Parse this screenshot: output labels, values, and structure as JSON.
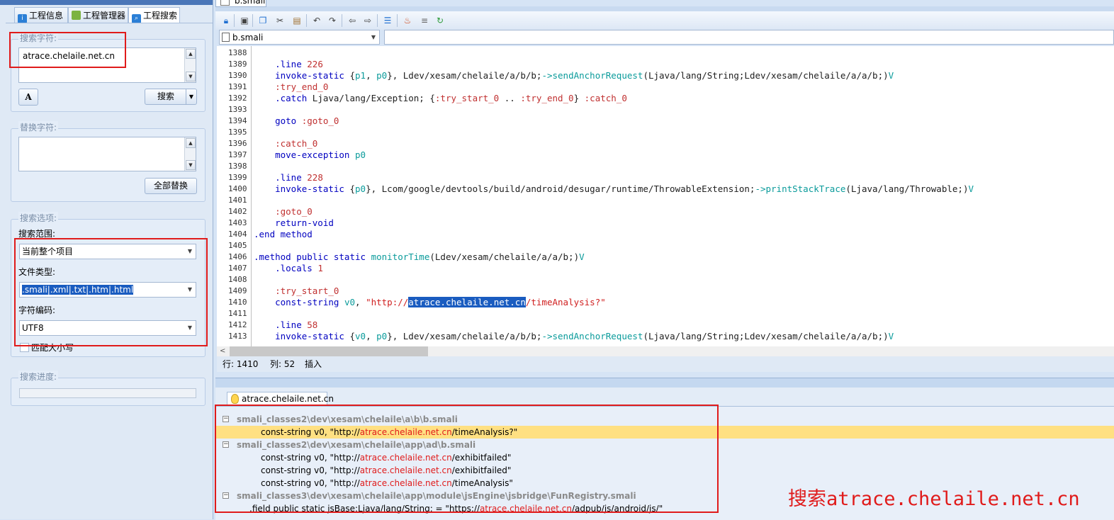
{
  "left_panel": {
    "tabs": [
      {
        "label": "工程信息",
        "icon": "info-icon",
        "color": "#2b7fd6"
      },
      {
        "label": "工程管理器",
        "icon": "android-icon",
        "color": "#7cb342"
      },
      {
        "label": "工程搜索",
        "icon": "search-icon",
        "color": "#2b7fd6"
      }
    ],
    "search": {
      "group_label": "搜索字符:",
      "value": "atrace.chelaile.net.cn",
      "search_button": "搜索"
    },
    "replace": {
      "group_label": "替换字符:",
      "value": "",
      "replace_all_button": "全部替换"
    },
    "options": {
      "group_label": "搜索选项:",
      "scope_label": "搜索范围:",
      "scope_value": "当前整个项目",
      "filetype_label": "文件类型:",
      "filetype_value": ".smali|.xml|.txt|.htm|.html",
      "encoding_label": "字符编码:",
      "encoding_value": "UTF8",
      "match_case_label": "匹配大小写"
    },
    "progress": {
      "group_label": "搜索进度:",
      "value": 0
    }
  },
  "editor": {
    "tab_label": "b.smali",
    "file_combo": "b.smali",
    "lines": [
      {
        "n": "1388",
        "segs": []
      },
      {
        "n": "1389",
        "segs": [
          [
            "kw",
            "    .line "
          ],
          [
            "lbl",
            "226"
          ]
        ]
      },
      {
        "n": "1390",
        "segs": [
          [
            "kw",
            "    invoke-static "
          ],
          [
            "txt",
            "{"
          ],
          [
            "reg",
            "p1"
          ],
          [
            "txt",
            ", "
          ],
          [
            "reg",
            "p0"
          ],
          [
            "txt",
            "}, Ldev/xesam/chelaile/a/b/b;"
          ],
          [
            "mth",
            "->sendAnchorRequest"
          ],
          [
            "txt",
            "(Ljava/lang/String;Ldev/xesam/chelaile/a/a/b;)"
          ],
          [
            "mth",
            "V"
          ]
        ]
      },
      {
        "n": "1391",
        "segs": [
          [
            "lbl",
            "    :try_end_0"
          ]
        ]
      },
      {
        "n": "1392",
        "segs": [
          [
            "kw",
            "    .catch "
          ],
          [
            "txt",
            "Ljava/lang/Exception; {"
          ],
          [
            "lbl",
            ":try_start_0"
          ],
          [
            "txt",
            " .. "
          ],
          [
            "lbl",
            ":try_end_0"
          ],
          [
            "txt",
            "} "
          ],
          [
            "lbl",
            ":catch_0"
          ]
        ]
      },
      {
        "n": "1393",
        "segs": []
      },
      {
        "n": "1394",
        "segs": [
          [
            "kw",
            "    goto "
          ],
          [
            "lbl",
            ":goto_0"
          ]
        ]
      },
      {
        "n": "1395",
        "segs": []
      },
      {
        "n": "1396",
        "segs": [
          [
            "lbl",
            "    :catch_0"
          ]
        ]
      },
      {
        "n": "1397",
        "segs": [
          [
            "kw",
            "    move-exception "
          ],
          [
            "reg",
            "p0"
          ]
        ]
      },
      {
        "n": "1398",
        "segs": []
      },
      {
        "n": "1399",
        "segs": [
          [
            "kw",
            "    .line "
          ],
          [
            "lbl",
            "228"
          ]
        ]
      },
      {
        "n": "1400",
        "segs": [
          [
            "kw",
            "    invoke-static "
          ],
          [
            "txt",
            "{"
          ],
          [
            "reg",
            "p0"
          ],
          [
            "txt",
            "}, Lcom/google/devtools/build/android/desugar/runtime/ThrowableExtension;"
          ],
          [
            "mth",
            "->printStackTrace"
          ],
          [
            "txt",
            "(Ljava/lang/Throwable;)"
          ],
          [
            "mth",
            "V"
          ]
        ]
      },
      {
        "n": "1401",
        "segs": []
      },
      {
        "n": "1402",
        "segs": [
          [
            "lbl",
            "    :goto_0"
          ]
        ]
      },
      {
        "n": "1403",
        "segs": [
          [
            "kw",
            "    return-void"
          ]
        ]
      },
      {
        "n": "1404",
        "segs": [
          [
            "kw",
            ".end method"
          ]
        ]
      },
      {
        "n": "1405",
        "segs": []
      },
      {
        "n": "1406",
        "segs": [
          [
            "kw",
            ".method public static "
          ],
          [
            "mth",
            "monitorTime"
          ],
          [
            "txt",
            "(Ldev/xesam/chelaile/a/a/b;)"
          ],
          [
            "mth",
            "V"
          ]
        ]
      },
      {
        "n": "1407",
        "segs": [
          [
            "kw",
            "    .locals "
          ],
          [
            "lbl",
            "1"
          ]
        ]
      },
      {
        "n": "1408",
        "segs": []
      },
      {
        "n": "1409",
        "segs": [
          [
            "lbl",
            "    :try_start_0"
          ]
        ]
      },
      {
        "n": "1410",
        "segs": [
          [
            "kw",
            "    const-string "
          ],
          [
            "reg",
            "v0"
          ],
          [
            "txt",
            ", "
          ],
          [
            "str",
            "\"http://"
          ],
          [
            "sel",
            "atrace.chelaile.net.cn"
          ],
          [
            "str",
            "/timeAnalysis?\""
          ]
        ]
      },
      {
        "n": "1411",
        "segs": []
      },
      {
        "n": "1412",
        "segs": [
          [
            "kw",
            "    .line "
          ],
          [
            "lbl",
            "58"
          ]
        ]
      },
      {
        "n": "1413",
        "segs": [
          [
            "kw",
            "    invoke-static "
          ],
          [
            "txt",
            "{"
          ],
          [
            "reg",
            "v0"
          ],
          [
            "txt",
            ", "
          ],
          [
            "reg",
            "p0"
          ],
          [
            "txt",
            "}, Ldev/xesam/chelaile/a/b/b;"
          ],
          [
            "mth",
            "->sendAnchorRequest"
          ],
          [
            "txt",
            "(Ljava/lang/String;Ldev/xesam/chelaile/a/a/b;)"
          ],
          [
            "mth",
            "V"
          ]
        ]
      }
    ],
    "status": {
      "row_label": "行: 1410",
      "col_label": "列: 52",
      "mode_label": "插入"
    }
  },
  "results": {
    "tab_label": "atrace.chelaile.net.cn",
    "rows": [
      {
        "kind": "file",
        "text": "smali_classes2\\dev\\xesam\\chelaile\\a\\b\\b.smali"
      },
      {
        "kind": "hit",
        "pre": "const-string v0, \"http://",
        "hit": "atrace.chelaile.net.cn",
        "post": "/timeAnalysis?\"",
        "highlighted": true
      },
      {
        "kind": "file",
        "text": "smali_classes2\\dev\\xesam\\chelaile\\app\\ad\\b.smali"
      },
      {
        "kind": "hit",
        "pre": "const-string v0, \"http://",
        "hit": "atrace.chelaile.net.cn",
        "post": "/exhibitfailed\""
      },
      {
        "kind": "hit",
        "pre": "const-string v0, \"http://",
        "hit": "atrace.chelaile.net.cn",
        "post": "/exhibitfailed\""
      },
      {
        "kind": "hit",
        "pre": "const-string v0, \"http://",
        "hit": "atrace.chelaile.net.cn",
        "post": "/timeAnalysis\""
      },
      {
        "kind": "file",
        "text": "smali_classes3\\dev\\xesam\\chelaile\\app\\module\\jsEngine\\jsbridge\\FunRegistry.smali"
      },
      {
        "kind": "hit2",
        "pre": ".field public static jsBase:Ljava/lang/String; = \"https://",
        "hit": "atrace.chelaile.net.cn",
        "post": "/adpub/js/android/js/\""
      }
    ],
    "annotation": "搜索atrace.chelaile.net.cn"
  },
  "colors": {
    "highlight_row": "#ffe082",
    "hit_text": "#e01b1b",
    "annotation_red": "#e01b1b",
    "selection": "#1a5cc0"
  }
}
